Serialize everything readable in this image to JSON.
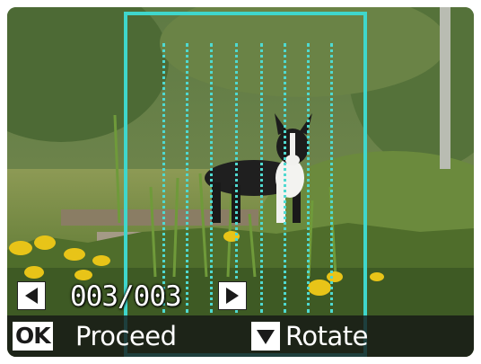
{
  "viewer": {
    "counter_text": "003/003"
  },
  "hints": {
    "ok_key": "OK",
    "proceed_label": "Proceed",
    "rotate_label": "Rotate"
  },
  "icons": {
    "prev": "left-triangle-icon",
    "next": "right-triangle-icon",
    "down": "down-triangle-icon"
  },
  "colors": {
    "frame": "#3fd6cc",
    "guides": "#4fd9d0",
    "hint_bar": "#141414",
    "badge": "#ffffff"
  }
}
